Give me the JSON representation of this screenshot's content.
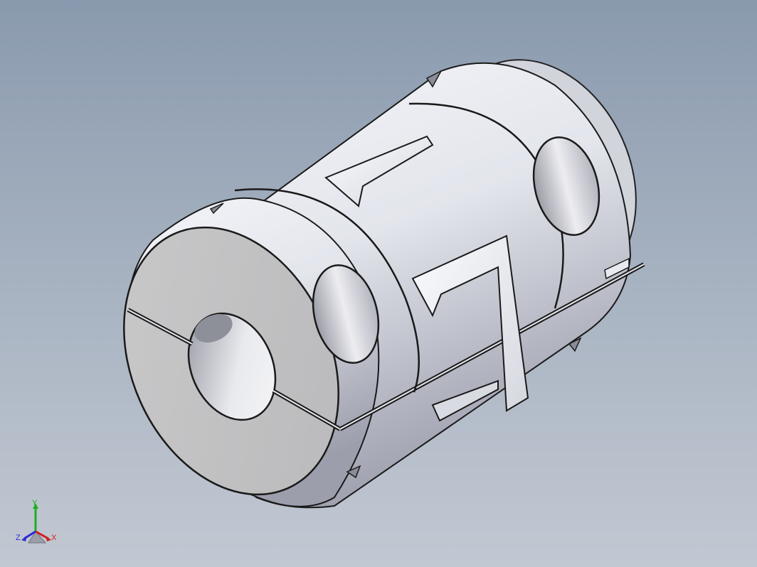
{
  "viewport": {
    "background_top": "#8a9aae",
    "background_bottom": "#c2c8d2"
  },
  "model": {
    "part": "jaw-coupling-clamp-type"
  },
  "triad": {
    "x_label": "X",
    "y_label": "Y",
    "z_label": "Z",
    "x_color": "#d21e1e",
    "y_color": "#1fae1f",
    "z_color": "#2b2bd6"
  }
}
